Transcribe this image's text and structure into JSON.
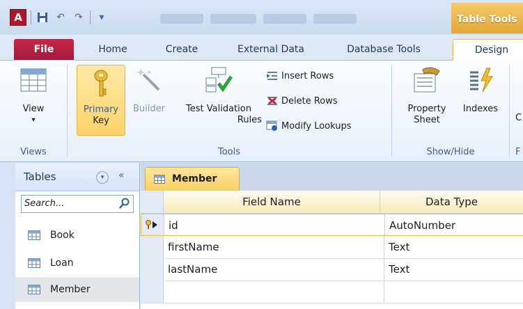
{
  "window": {
    "context_tab_label": "Table Tools",
    "qat_icons": [
      "access-app-icon",
      "save-icon",
      "undo-icon",
      "redo-icon",
      "customize-qat-icon"
    ]
  },
  "ribbon_tabs": [
    {
      "label": "File"
    },
    {
      "label": "Home"
    },
    {
      "label": "Create"
    },
    {
      "label": "External Data"
    },
    {
      "label": "Database Tools"
    },
    {
      "label": "Design"
    }
  ],
  "ribbon": {
    "views": {
      "group_label": "Views",
      "view_label": "View"
    },
    "tools": {
      "group_label": "Tools",
      "primary_key_line1": "Primary",
      "primary_key_line2": "Key",
      "builder_label": "Builder",
      "test_validation_line1": "Test Validation",
      "test_validation_line2": "Rules",
      "insert_rows": "Insert Rows",
      "delete_rows": "Delete Rows",
      "modify_lookups": "Modify Lookups"
    },
    "show_hide": {
      "group_label": "Show/Hide",
      "property_sheet_line1": "Property",
      "property_sheet_line2": "Sheet",
      "indexes_label": "Indexes"
    },
    "clipped_next_group": {
      "label_fragment": "C",
      "group_fragment": "F"
    }
  },
  "nav_pane": {
    "title": "Tables",
    "collapse_glyph": "«",
    "search_placeholder": "Search...",
    "items": [
      {
        "label": "Book"
      },
      {
        "label": "Loan"
      },
      {
        "label": "Member"
      }
    ]
  },
  "document": {
    "tab_label": "Member",
    "columns": {
      "field_name": "Field Name",
      "data_type": "Data Type"
    },
    "rows": [
      {
        "field": "id",
        "type": "AutoNumber"
      },
      {
        "field": "firstName",
        "type": "Text"
      },
      {
        "field": "lastName",
        "type": "Text"
      },
      {
        "field": "",
        "type": ""
      }
    ]
  },
  "colors": {
    "file_tab": "#b81f42",
    "context_tab": "#eeb94d",
    "active_button": "#fbd36a",
    "ribbon_bg": "#f3f7fc"
  }
}
